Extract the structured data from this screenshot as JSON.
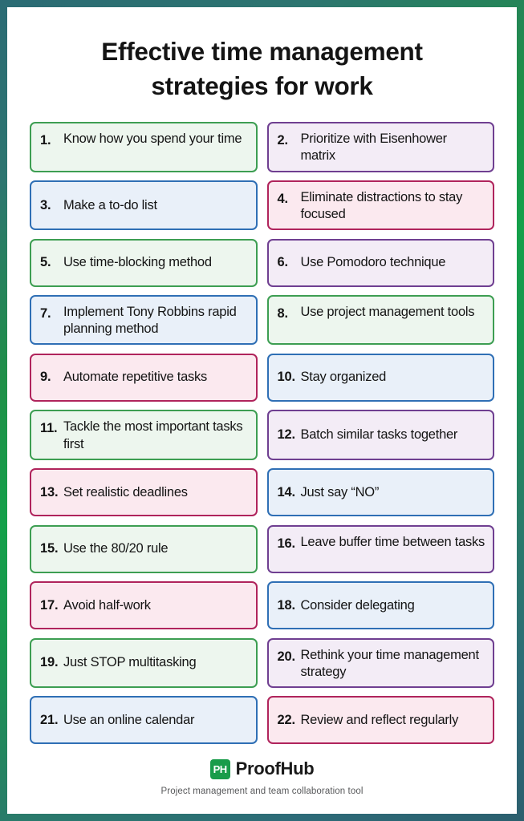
{
  "theme": {
    "border_gradient_start": "#2b6b74",
    "border_gradient_mid": "#14a04a",
    "border_gradient_end": "#2c5f6e",
    "sheet_background": "#ffffff",
    "text_color": "#141414",
    "green_border": "#3d9e52",
    "green_fill": "#edf6ee",
    "blue_border": "#2f6fb5",
    "blue_fill": "#e9f0f9",
    "purple_border": "#6f3f91",
    "purple_fill": "#f3ecf6",
    "crimson_border": "#b0245c",
    "crimson_fill": "#fbe9ef"
  },
  "title": "Effective time management strategies for work",
  "cards": [
    {
      "num": "1.",
      "text": "Know how you spend your time",
      "color": "green",
      "lines": 2
    },
    {
      "num": "2.",
      "text": "Prioritize with Eisenhower matrix",
      "color": "purple",
      "lines": 2
    },
    {
      "num": "3.",
      "text": "Make a to-do list",
      "color": "blue",
      "lines": 1
    },
    {
      "num": "4.",
      "text": "Eliminate distractions to stay focused",
      "color": "crimson",
      "lines": 2
    },
    {
      "num": "5.",
      "text": "Use time-blocking method",
      "color": "green",
      "lines": 1
    },
    {
      "num": "6.",
      "text": "Use Pomodoro technique",
      "color": "purple",
      "lines": 1
    },
    {
      "num": "7.",
      "text": "Implement Tony Robbins rapid planning method",
      "color": "blue",
      "lines": 2
    },
    {
      "num": "8.",
      "text": "Use project management tools",
      "color": "green",
      "lines": 2
    },
    {
      "num": "9.",
      "text": "Automate repetitive tasks",
      "color": "crimson",
      "lines": 1
    },
    {
      "num": "10.",
      "text": "Stay organized",
      "color": "blue",
      "lines": 1
    },
    {
      "num": "11.",
      "text": "Tackle the most important tasks first",
      "color": "green",
      "lines": 2
    },
    {
      "num": "12.",
      "text": "Batch similar tasks together",
      "color": "purple",
      "lines": 1
    },
    {
      "num": "13.",
      "text": "Set realistic deadlines",
      "color": "crimson",
      "lines": 1
    },
    {
      "num": "14.",
      "text": "Just say “NO”",
      "color": "blue",
      "lines": 1
    },
    {
      "num": "15.",
      "text": "Use the 80/20 rule",
      "color": "green",
      "lines": 1
    },
    {
      "num": "16.",
      "text": "Leave buffer time between tasks",
      "color": "purple",
      "lines": 2
    },
    {
      "num": "17.",
      "text": "Avoid half-work",
      "color": "crimson",
      "lines": 1
    },
    {
      "num": "18.",
      "text": "Consider delegating",
      "color": "blue",
      "lines": 1
    },
    {
      "num": "19.",
      "text": "Just STOP multitasking",
      "color": "green",
      "lines": 1
    },
    {
      "num": "20.",
      "text": "Rethink your time management strategy",
      "color": "purple",
      "lines": 2
    },
    {
      "num": "21.",
      "text": "Use an online calendar",
      "color": "blue",
      "lines": 1
    },
    {
      "num": "22.",
      "text": "Review and reflect regularly",
      "color": "crimson",
      "lines": 1
    }
  ],
  "footer": {
    "logo_mark": "PH",
    "brand_name": "ProofHub",
    "tagline": "Project management and team collaboration tool"
  }
}
